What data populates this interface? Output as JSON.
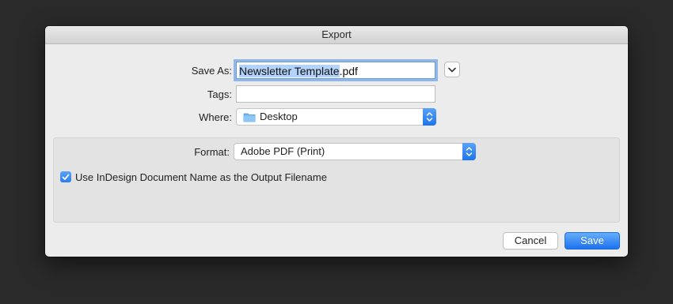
{
  "dialog": {
    "title": "Export",
    "save_as": {
      "label": "Save As:",
      "value_selected": "Newsletter Template",
      "value_rest": ".pdf"
    },
    "tags": {
      "label": "Tags:",
      "value": ""
    },
    "where": {
      "label": "Where:",
      "value": "Desktop",
      "icon": "folder-icon"
    },
    "format": {
      "label": "Format:",
      "value": "Adobe PDF (Print)"
    },
    "use_doc_name": {
      "label": "Use InDesign Document Name as the Output Filename",
      "checked": true
    },
    "buttons": {
      "cancel": "Cancel",
      "save": "Save"
    },
    "colors": {
      "accent": "#1e74f0",
      "background": "#ececec",
      "desktop_bg": "#2a2a2a"
    }
  }
}
